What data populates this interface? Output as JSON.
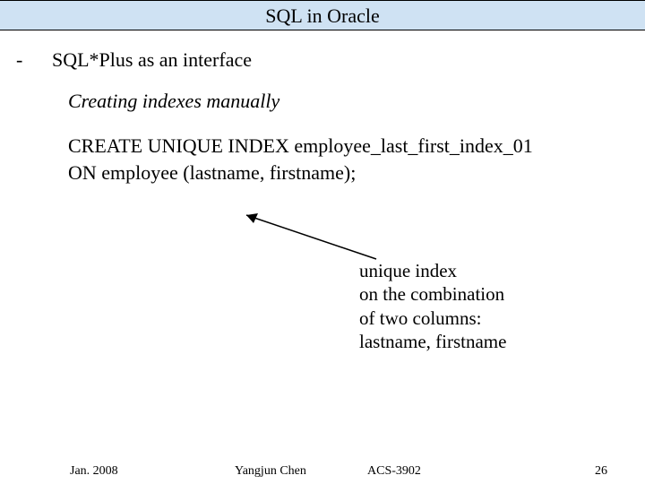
{
  "title": "SQL in Oracle",
  "bullet": {
    "dash": "-",
    "text": "SQL*Plus as an interface"
  },
  "heading": "Creating indexes manually",
  "code": {
    "line1": "CREATE UNIQUE INDEX employee_last_first_index_01",
    "line2": "ON employee (lastname, firstname);"
  },
  "annotation": {
    "l1": "unique index",
    "l2": "on the combination",
    "l3": "of two columns:",
    "l4": "lastname, firstname"
  },
  "footer": {
    "date": "Jan. 2008",
    "author": "Yangjun Chen",
    "course": "ACS-3902",
    "page": "26"
  }
}
